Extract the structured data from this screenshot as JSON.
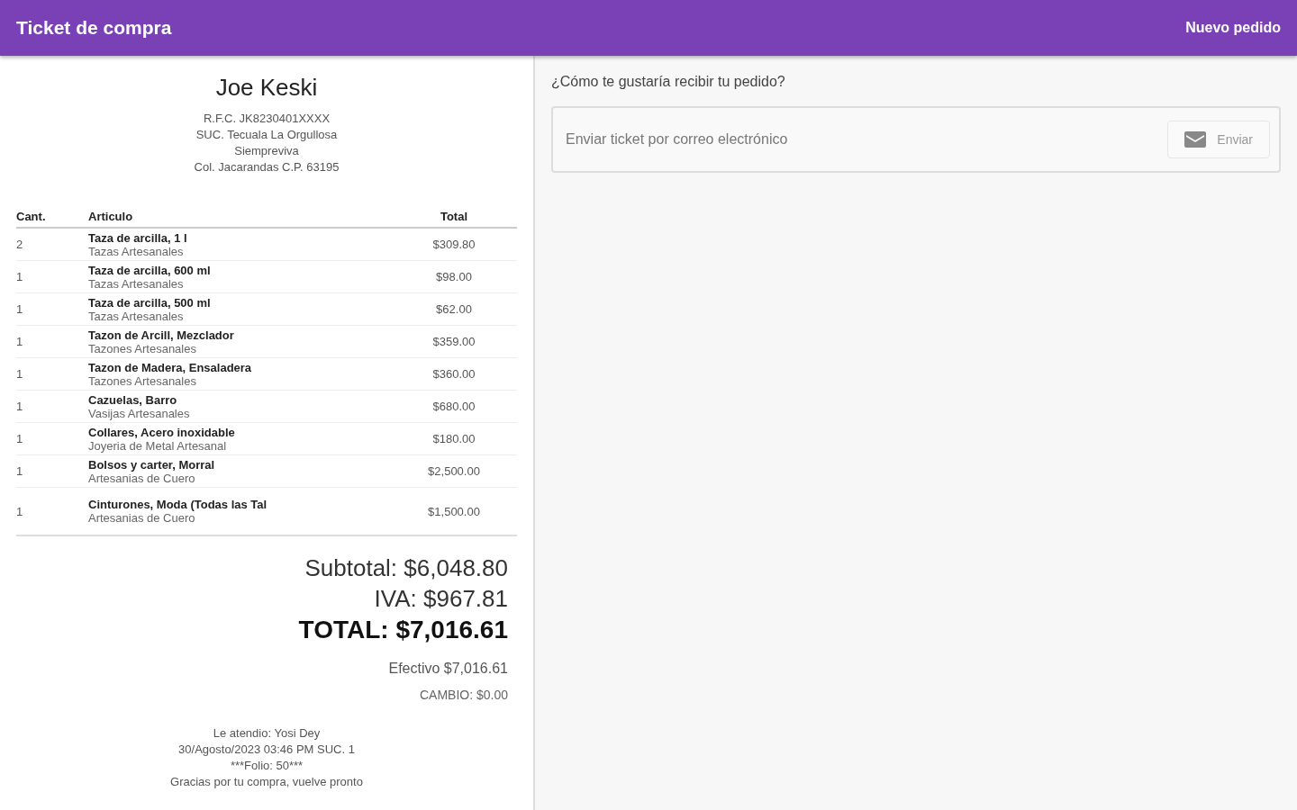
{
  "app_bar": {
    "title": "Ticket de compra",
    "action": "Nuevo pedido"
  },
  "ticket": {
    "customer": "Joe Keski",
    "header_lines": [
      "R.F.C. JK8230401XXXX",
      "SUC. Tecuala La Orgullosa",
      "Siempreviva",
      "Col. Jacarandas C.P. 63195"
    ],
    "columns": [
      "Cant.",
      "Articulo",
      "Total"
    ],
    "rows": [
      {
        "qty": "2",
        "name": "Taza de arcilla, 1 l",
        "category": "Tazas Artesanales",
        "total": "$309.80"
      },
      {
        "qty": "1",
        "name": "Taza de arcilla, 600 ml",
        "category": "Tazas Artesanales",
        "total": "$98.00"
      },
      {
        "qty": "1",
        "name": "Taza de arcilla, 500 ml",
        "category": "Tazas Artesanales",
        "total": "$62.00"
      },
      {
        "qty": "1",
        "name": "Tazon de Arcill, Mezclador",
        "category": "Tazones Artesanales",
        "total": "$359.00"
      },
      {
        "qty": "1",
        "name": "Tazon de Madera, Ensaladera",
        "category": "Tazones Artesanales",
        "total": "$360.00"
      },
      {
        "qty": "1",
        "name": "Cazuelas, Barro",
        "category": "Vasijas Artesanales",
        "total": "$680.00"
      },
      {
        "qty": "1",
        "name": "Collares, Acero inoxidable",
        "category": "Joyeria de Metal Artesanal",
        "total": "$180.00"
      },
      {
        "qty": "1",
        "name": "Bolsos y carter, Morral",
        "category": "Artesanias de Cuero",
        "total": "$2,500.00"
      },
      {
        "qty": "1",
        "name": "Cinturones, Moda (Todas las Tal",
        "category": "Artesanias de Cuero",
        "total": "$1,500.00"
      }
    ],
    "subtotal": "Subtotal: $6,048.80",
    "tax": "IVA: $967.81",
    "total": "TOTAL: $7,016.61",
    "payment": "Efectivo $7,016.61",
    "change": "CAMBIO: $0.00",
    "footer_lines": [
      "Le atendio: Yosi Dey",
      "30/Agosto/2023 03:46 PM SUC. 1",
      "***Folio: 50***",
      "Gracias por tu compra, vuelve pronto"
    ]
  },
  "delivery": {
    "question": "¿Cómo te gustaría recibir tu pedido?",
    "email_field": {
      "placeholder": "Enviar ticket por correo electrónico"
    },
    "send_button": {
      "label": "Enviar",
      "disabled": true
    }
  }
}
